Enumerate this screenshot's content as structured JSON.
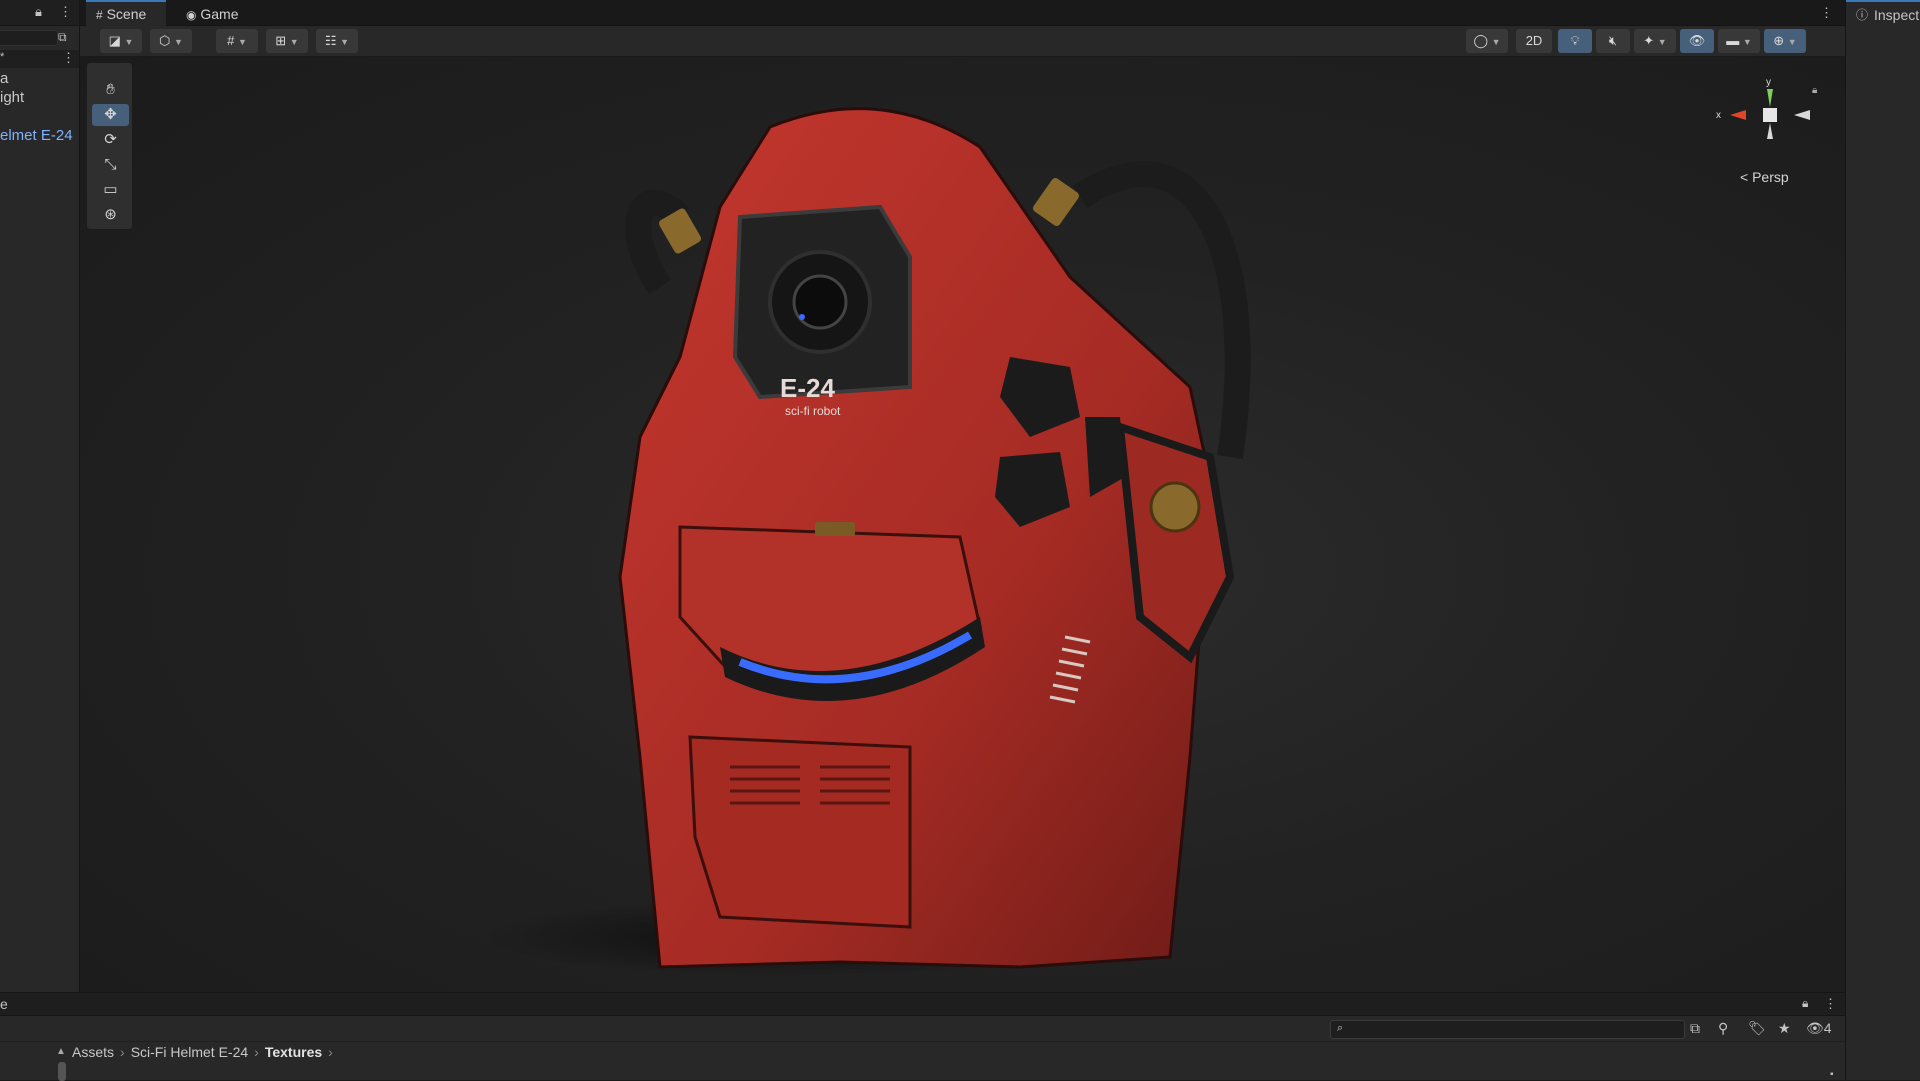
{
  "hierarchy": {
    "items": [
      "a",
      "ight",
      "elmet E-24"
    ],
    "selected_index": 2
  },
  "scene_tabs": [
    {
      "label": "Scene",
      "icon": "grid-icon",
      "active": true
    },
    {
      "label": "Game",
      "icon": "gamepad-icon",
      "active": false
    }
  ],
  "scene_toolbar": {
    "toggle_2d_label": "2D",
    "persp_label": "Persp",
    "gizmo_axes": {
      "x": "x",
      "y": "y"
    }
  },
  "tools": [
    "hand-tool",
    "move-tool",
    "rotate-tool",
    "scale-tool",
    "rect-tool",
    "transform-tool"
  ],
  "active_tool": "move-tool",
  "model": {
    "name_text": "E-24",
    "sub_text": "sci-fi robot",
    "accent": "#b8302a",
    "glow": "#3a6bff"
  },
  "inspector": {
    "tab_label": "Inspect"
  },
  "project": {
    "tab_label": "e",
    "breadcrumb": [
      "Assets",
      "Sci-Fi Helmet E-24",
      "Textures"
    ],
    "hidden_count": "4"
  },
  "colors": {
    "accent_blue": "#46607c",
    "panel": "#282828",
    "dark": "#191919"
  }
}
